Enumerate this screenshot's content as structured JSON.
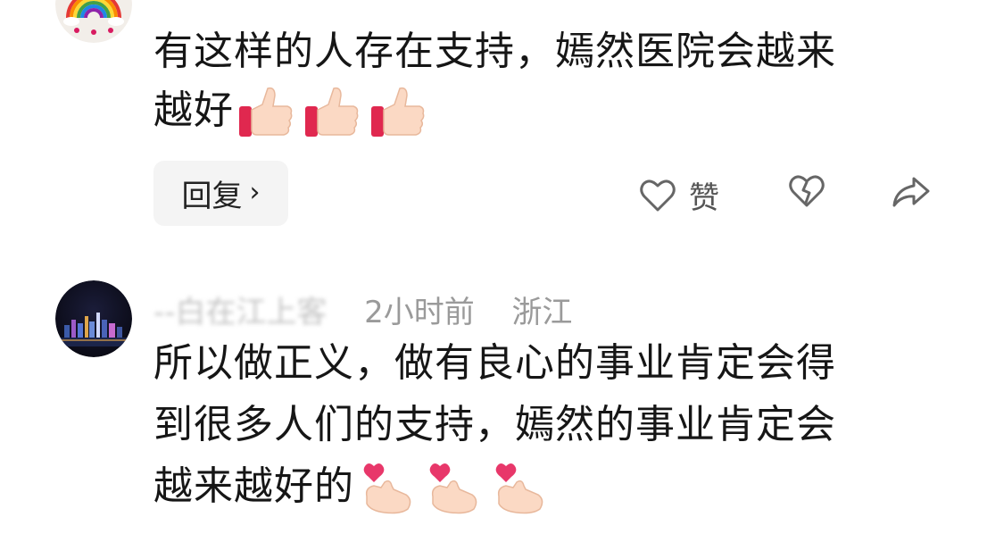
{
  "comment1": {
    "author": "",
    "meta_blurred": "",
    "lines": [
      "有这样的人存在支持，嫣然医院会越来",
      "越好"
    ],
    "emojis": [
      "thumbs-up",
      "thumbs-up",
      "thumbs-up"
    ],
    "reply_label": "回复",
    "reply_chevron": "›",
    "like_label": "赞",
    "icons": [
      "heart-outline-icon",
      "broken-heart-icon",
      "share-icon"
    ]
  },
  "comment2": {
    "author_blurred": "--白在江上客",
    "time": "2小时前",
    "location": "浙江",
    "lines": [
      "所以做正义，做有良心的事业肯定会得",
      "到很多人们的支持，嫣然的事业肯定会",
      "越来越好的"
    ],
    "emojis": [
      "finger-heart",
      "finger-heart",
      "finger-heart"
    ]
  },
  "colors": {
    "text": "#161616",
    "meta": "#9a9a9a",
    "reply_bg": "#f4f4f4",
    "icon": "#666666"
  }
}
